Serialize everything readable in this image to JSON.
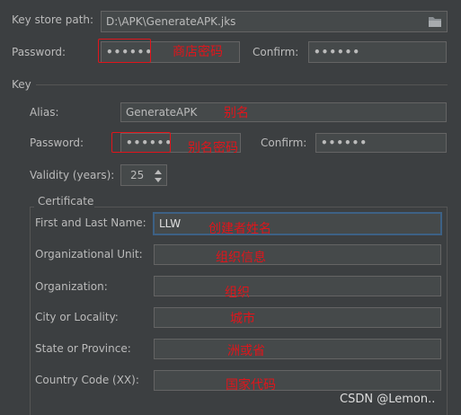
{
  "keystore": {
    "path_label": "Key store path:",
    "path_value": "D:\\APK\\GenerateAPK.jks",
    "password_label": "Password:",
    "password_value": "••••••",
    "confirm_label": "Confirm:",
    "confirm_value": "••••••"
  },
  "key": {
    "section_label": "Key",
    "alias_label": "Alias:",
    "alias_value": "GenerateAPK",
    "password_label": "Password:",
    "password_value": "••••••",
    "confirm_label": "Confirm:",
    "confirm_value": "••••••",
    "validity_label": "Validity (years):",
    "validity_value": "25"
  },
  "certificate": {
    "section_label": "Certificate",
    "first_last_label": "First and Last Name:",
    "first_last_value": "LLW",
    "org_unit_label": "Organizational Unit:",
    "org_unit_value": "",
    "organization_label": "Organization:",
    "organization_value": "",
    "city_label": "City or Locality:",
    "city_value": "",
    "state_label": "State or Province:",
    "state_value": "",
    "country_label": "Country Code (XX):",
    "country_value": ""
  },
  "annotations": {
    "store_password": "商店密码",
    "alias": "别名",
    "alias_password": "别名密码",
    "creator_name": "创建者姓名",
    "org_info": "组织信息",
    "organization": "组织",
    "city": "城市",
    "province": "洲或省",
    "country_code": "国家代码"
  },
  "watermark": "CSDN @Lemon.."
}
